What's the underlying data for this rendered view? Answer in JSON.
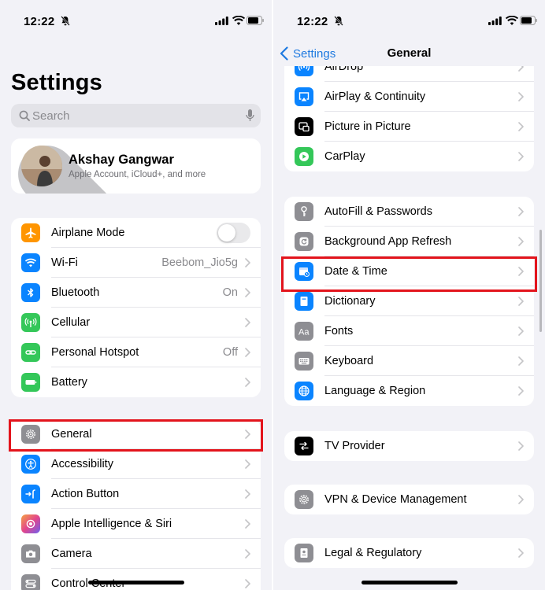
{
  "status": {
    "time": "12:22"
  },
  "left": {
    "title": "Settings",
    "search_placeholder": "Search",
    "profile": {
      "name": "Akshay Gangwar",
      "subtitle": "Apple Account, iCloud+, and more"
    },
    "group1": [
      {
        "label": "Airplane Mode",
        "value": "",
        "icon": "airplane-icon",
        "color": "#ff9500",
        "toggle": true
      },
      {
        "label": "Wi-Fi",
        "value": "Beebom_Jio5g",
        "icon": "wifi-icon",
        "color": "#0a84ff"
      },
      {
        "label": "Bluetooth",
        "value": "On",
        "icon": "bluetooth-icon",
        "color": "#0a84ff"
      },
      {
        "label": "Cellular",
        "value": "",
        "icon": "cellular-icon",
        "color": "#34c759"
      },
      {
        "label": "Personal Hotspot",
        "value": "Off",
        "icon": "hotspot-icon",
        "color": "#34c759"
      },
      {
        "label": "Battery",
        "value": "",
        "icon": "battery-icon",
        "color": "#34c759"
      }
    ],
    "group2": [
      {
        "label": "General",
        "icon": "gear-icon",
        "color": "#8e8e93"
      },
      {
        "label": "Accessibility",
        "icon": "accessibility-icon",
        "color": "#0a84ff"
      },
      {
        "label": "Action Button",
        "icon": "action-button-icon",
        "color": "#0a84ff"
      },
      {
        "label": "Apple Intelligence & Siri",
        "icon": "siri-icon",
        "color": "#c86dd7"
      },
      {
        "label": "Camera",
        "icon": "camera-icon",
        "color": "#8e8e93"
      },
      {
        "label": "Control Center",
        "icon": "control-center-icon",
        "color": "#8e8e93"
      }
    ]
  },
  "right": {
    "back_label": "Settings",
    "nav_title": "General",
    "group1": [
      {
        "label": "AirDrop",
        "icon": "airdrop-icon",
        "color": "#0a84ff"
      },
      {
        "label": "AirPlay & Continuity",
        "icon": "airplay-icon",
        "color": "#0a84ff"
      },
      {
        "label": "Picture in Picture",
        "icon": "pip-icon",
        "color": "#000000"
      },
      {
        "label": "CarPlay",
        "icon": "carplay-icon",
        "color": "#34c759"
      }
    ],
    "group2": [
      {
        "label": "AutoFill & Passwords",
        "icon": "key-icon",
        "color": "#8e8e93"
      },
      {
        "label": "Background App Refresh",
        "icon": "refresh-icon",
        "color": "#8e8e93"
      },
      {
        "label": "Date & Time",
        "icon": "calendar-clock-icon",
        "color": "#0a84ff"
      },
      {
        "label": "Dictionary",
        "icon": "book-icon",
        "color": "#0a84ff"
      },
      {
        "label": "Fonts",
        "icon": "fonts-icon",
        "color": "#8e8e93"
      },
      {
        "label": "Keyboard",
        "icon": "keyboard-icon",
        "color": "#8e8e93"
      },
      {
        "label": "Language & Region",
        "icon": "globe-icon",
        "color": "#0a84ff"
      }
    ],
    "group3": [
      {
        "label": "TV Provider",
        "icon": "tv-provider-icon",
        "color": "#000000"
      }
    ],
    "group4": [
      {
        "label": "VPN & Device Management",
        "icon": "gear-icon",
        "color": "#8e8e93"
      }
    ],
    "group5": [
      {
        "label": "Legal & Regulatory",
        "icon": "legal-icon",
        "color": "#8e8e93"
      }
    ]
  }
}
